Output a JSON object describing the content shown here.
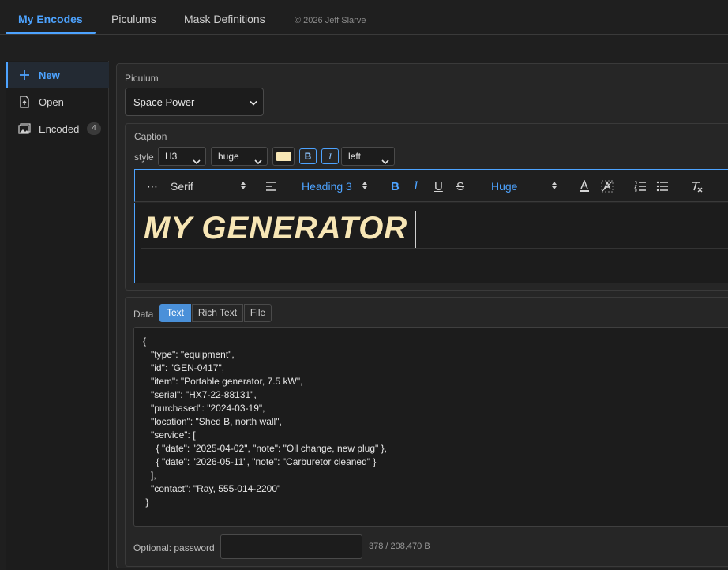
{
  "nav": {
    "tabs": [
      {
        "label": "My Encodes",
        "active": true
      },
      {
        "label": "Piculums",
        "active": false
      },
      {
        "label": "Mask Definitions",
        "active": false
      }
    ],
    "copyright": "© 2026 Jeff Slarve"
  },
  "sidebar": {
    "items": [
      {
        "label": "New",
        "icon": "plus-icon",
        "active": true
      },
      {
        "label": "Open",
        "icon": "file-upload-icon"
      },
      {
        "label": "Encoded",
        "icon": "image-icon",
        "badge": "4"
      }
    ]
  },
  "piculum": {
    "label": "Piculum",
    "selected": "Space Power"
  },
  "caption": {
    "label": "Caption",
    "style_label": "style",
    "heading_select": "H3",
    "size_select": "huge",
    "bold_label": "B",
    "italic_label": "I",
    "align_select": "left",
    "text_color": "#f7e6b5",
    "toolbar": {
      "more": "⋯",
      "font": "Serif",
      "heading": "Heading 3",
      "bold": "B",
      "italic": "I",
      "underline": "U",
      "strike": "S",
      "size": "Huge"
    },
    "text": "MY GENERATOR"
  },
  "data": {
    "label": "Data",
    "modes": [
      {
        "label": "Text",
        "active": true
      },
      {
        "label": "Rich Text",
        "active": false
      },
      {
        "label": "File",
        "active": false
      }
    ],
    "content": "{\n   \"type\": \"equipment\",\n   \"id\": \"GEN-0417\",\n   \"item\": \"Portable generator, 7.5 kW\",\n   \"serial\": \"HX7-22-88131\",\n   \"purchased\": \"2024-03-19\",\n   \"location\": \"Shed B, north wall\",\n   \"service\": [\n     { \"date\": \"2025-04-02\", \"note\": \"Oil change, new plug\" },\n     { \"date\": \"2026-05-11\", \"note\": \"Carburetor cleaned\" }\n   ],\n   \"contact\": \"Ray, 555-014-2200\"\n }",
    "password_label": "Optional: password",
    "password_value": "",
    "size_info": "378 / 208,470 B"
  },
  "colors": {
    "accent": "#4da3ff",
    "active_segment": "#4a90d9",
    "caption_text": "#f7e6b5"
  }
}
